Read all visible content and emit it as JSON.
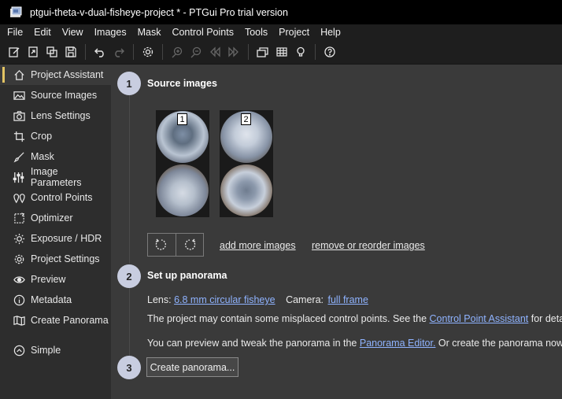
{
  "window": {
    "title": "ptgui-theta-v-dual-fisheye-project * - PTGui Pro trial version"
  },
  "menu": [
    "File",
    "Edit",
    "View",
    "Images",
    "Mask",
    "Control Points",
    "Tools",
    "Project",
    "Help"
  ],
  "toolbar": {
    "icons": [
      "new-project-icon",
      "open-project-icon",
      "copy-icon",
      "save-icon",
      "undo-icon",
      "redo-icon",
      "settings-icon",
      "zoom-in-icon",
      "zoom-out-icon",
      "rewind-icon",
      "fast-forward-icon",
      "panorama-editor-icon",
      "grid-icon",
      "lightbulb-icon",
      "help-icon"
    ]
  },
  "sidebar": {
    "items": [
      {
        "label": "Project Assistant",
        "icon": "home-icon"
      },
      {
        "label": "Source Images",
        "icon": "image-icon"
      },
      {
        "label": "Lens Settings",
        "icon": "camera-icon"
      },
      {
        "label": "Crop",
        "icon": "crop-icon"
      },
      {
        "label": "Mask",
        "icon": "brush-icon"
      },
      {
        "label": "Image Parameters",
        "icon": "sliders-icon"
      },
      {
        "label": "Control Points",
        "icon": "map-pin-icon"
      },
      {
        "label": "Optimizer",
        "icon": "optimizer-icon"
      },
      {
        "label": "Exposure / HDR",
        "icon": "sun-icon"
      },
      {
        "label": "Project Settings",
        "icon": "gear-icon"
      },
      {
        "label": "Preview",
        "icon": "eye-icon"
      },
      {
        "label": "Metadata",
        "icon": "info-icon"
      },
      {
        "label": "Create Panorama",
        "icon": "map-icon"
      }
    ],
    "simple": {
      "label": "Simple",
      "icon": "chevron-up-circle-icon"
    }
  },
  "main": {
    "step1": {
      "num": "1",
      "title": "Source images",
      "thumbs": [
        "1",
        "2"
      ],
      "add_link": "add more images",
      "remove_link": "remove or reorder images"
    },
    "step2": {
      "num": "2",
      "title": "Set up panorama",
      "lens_label": "Lens:",
      "lens_value": "6.8 mm circular fisheye",
      "camera_label": "Camera:",
      "camera_value": "full frame",
      "cp_text_a": "The project may contain some misplaced control points. See the ",
      "cp_link": "Control Point Assistant",
      "cp_text_b": " for details.",
      "preview_text_a": "You can preview and tweak the panorama in the ",
      "preview_link": "Panorama Editor.",
      "preview_text_b": " Or create the panorama now:"
    },
    "step3": {
      "num": "3",
      "button": "Create panorama..."
    }
  }
}
